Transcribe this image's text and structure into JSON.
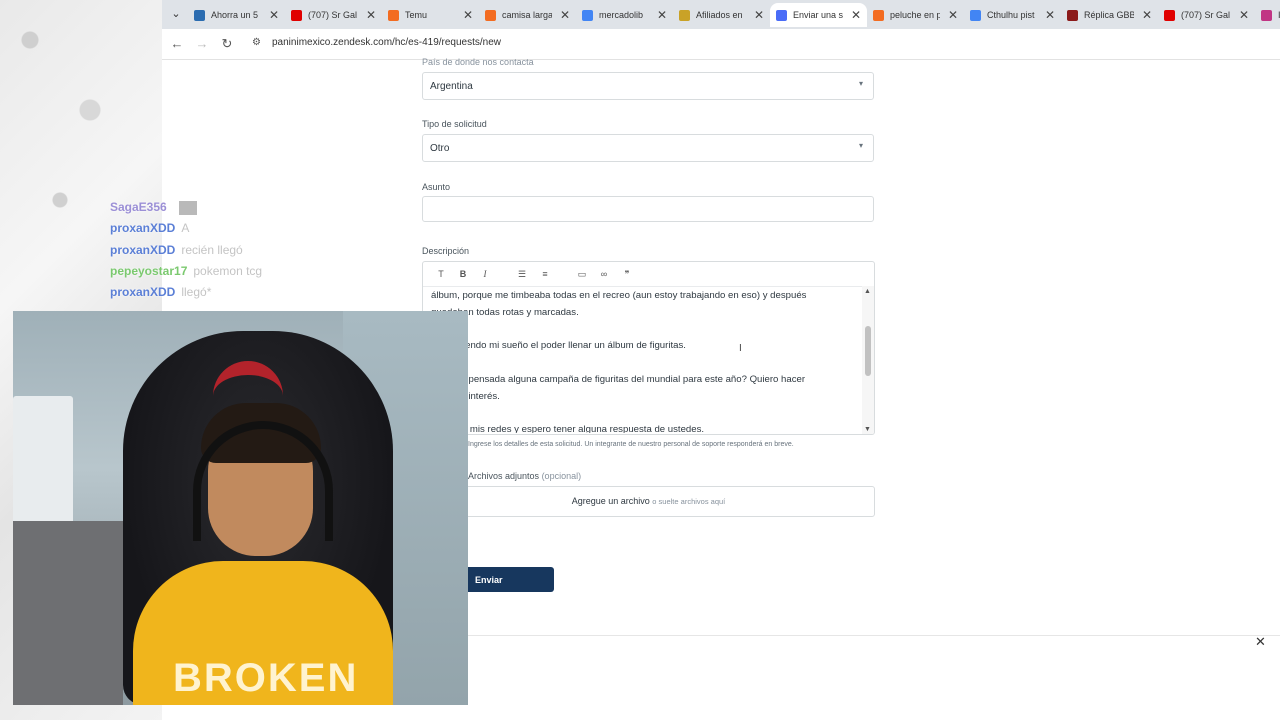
{
  "browser": {
    "tabs": [
      {
        "label": "Ahorra un 5",
        "favicon_color": "#2b6cb0"
      },
      {
        "label": "(707) Sr Gal",
        "favicon_color": "#e00000"
      },
      {
        "label": "Temu",
        "favicon_color": "#f36c21"
      },
      {
        "label": "camisa larga",
        "favicon_color": "#f36c21"
      },
      {
        "label": "mercadolib",
        "favicon_color": "#4285f4"
      },
      {
        "label": "Afiliados en",
        "favicon_color": "#c9a227"
      },
      {
        "label": "Enviar una s",
        "favicon_color": "#4a6cf7",
        "active": true
      },
      {
        "label": "peluche en p",
        "favicon_color": "#f36c21"
      },
      {
        "label": "Cthulhu pist",
        "favicon_color": "#4285f4"
      },
      {
        "label": "Réplica GBB",
        "favicon_color": "#8b1a1a"
      },
      {
        "label": "(707) Sr Gal",
        "favicon_color": "#e00000"
      },
      {
        "label": "Ir",
        "favicon_color": "#c13584"
      }
    ],
    "url": "paninimexico.zendesk.com/hc/es-419/requests/new"
  },
  "form": {
    "country_label": "País de donde nos contacta",
    "country_value": "Argentina",
    "request_type_label": "Tipo de solicitud",
    "request_type_value": "Otro",
    "subject_label": "Asunto",
    "subject_value": "",
    "description_label": "Descripción",
    "description_lines": [
      "álbum, porque me timbeaba todas en el recreo  (aun estoy trabajando en eso) y después",
      "quedaban todas rotas y marcadas.",
      "",
      "Sigue siendo mi sueño el poder llenar un álbum de figuritas.",
      "",
      "¿Tienen pensada alguna campaña de figuritas del mundial para este año? Quiero hacer",
      "notar mi interés.",
      "",
      "Les dejo mis redes y espero tener alguna respuesta de ustedes."
    ],
    "description_hint": "Ingrese los detalles de esta solicitud. Un integrante de nuestro personal de soporte responderá en breve.",
    "attachments_label": "Archivos adjuntos",
    "attachments_optional": "(opcional)",
    "dropzone_main": "Agregue un archivo",
    "dropzone_sub": "o suelte archivos aquí",
    "submit_label": "Enviar"
  },
  "chat": [
    {
      "user": "SagaE356",
      "message": "",
      "color": "#9b8fd6"
    },
    {
      "user": "proxanXDD",
      "message": "A",
      "color": "#5b7fd6"
    },
    {
      "user": "proxanXDD",
      "message": "recién llegó",
      "color": "#5b7fd6"
    },
    {
      "user": "pepeyostar17",
      "message": "pokemon tcg",
      "color": "#7bc96f"
    },
    {
      "user": "proxanXDD",
      "message": "llegó*",
      "color": "#5b7fd6"
    }
  ],
  "webcam": {
    "shirt_text": "BROKEN"
  }
}
